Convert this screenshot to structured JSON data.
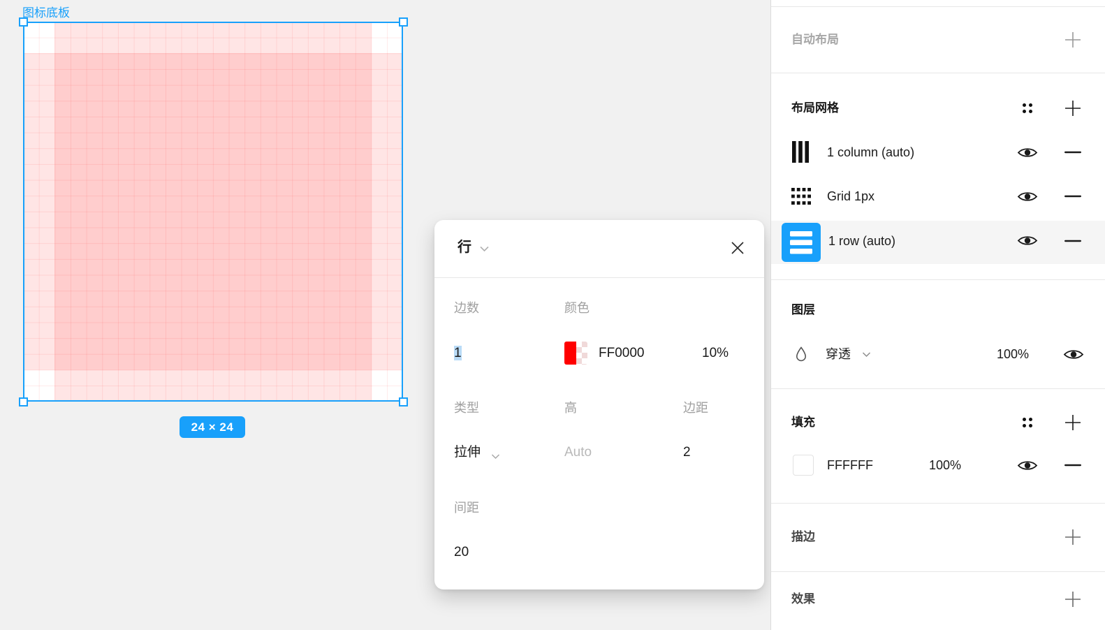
{
  "canvas": {
    "frame_label": "图标底板",
    "size_badge": "24 × 24"
  },
  "dialog": {
    "title": "行",
    "fields": {
      "count": {
        "label": "边数",
        "value": "1"
      },
      "color": {
        "label": "颜色",
        "hex": "FF0000",
        "opacity": "10%"
      },
      "type": {
        "label": "类型",
        "value": "拉伸"
      },
      "height": {
        "label": "高",
        "placeholder": "Auto"
      },
      "margin": {
        "label": "边距",
        "value": "2"
      },
      "gutter": {
        "label": "间距",
        "value": "20"
      }
    }
  },
  "panel": {
    "auto_layout": {
      "title": "自动布局"
    },
    "layout_grid": {
      "title": "布局网格",
      "rows": [
        {
          "label": "1 column (auto)",
          "icon": "columns-icon"
        },
        {
          "label": "Grid 1px",
          "icon": "grid-dots-icon"
        },
        {
          "label": "1 row (auto)",
          "icon": "rows-icon",
          "selected": true
        }
      ]
    },
    "layers": {
      "title": "图层",
      "blend_mode": "穿透",
      "opacity": "100%"
    },
    "fill": {
      "title": "填充",
      "row": {
        "hex": "FFFFFF",
        "opacity": "100%"
      }
    },
    "stroke": {
      "title": "描边"
    },
    "effects": {
      "title": "效果"
    }
  },
  "icons": {
    "close": "✕",
    "chevron_down": "⌄",
    "eye": "◉",
    "minus": "−",
    "plus": "+",
    "styles_dots": "∷",
    "columns": "▮▮▮",
    "grid_1px": "⣿",
    "rows": "≡",
    "blend_droplet": "◇"
  },
  "colors": {
    "accent_blue": "#18A0FB",
    "grid_red": "#FF0000",
    "fill_white": "#FFFFFF",
    "row_highlight": "#F5F5F5"
  }
}
